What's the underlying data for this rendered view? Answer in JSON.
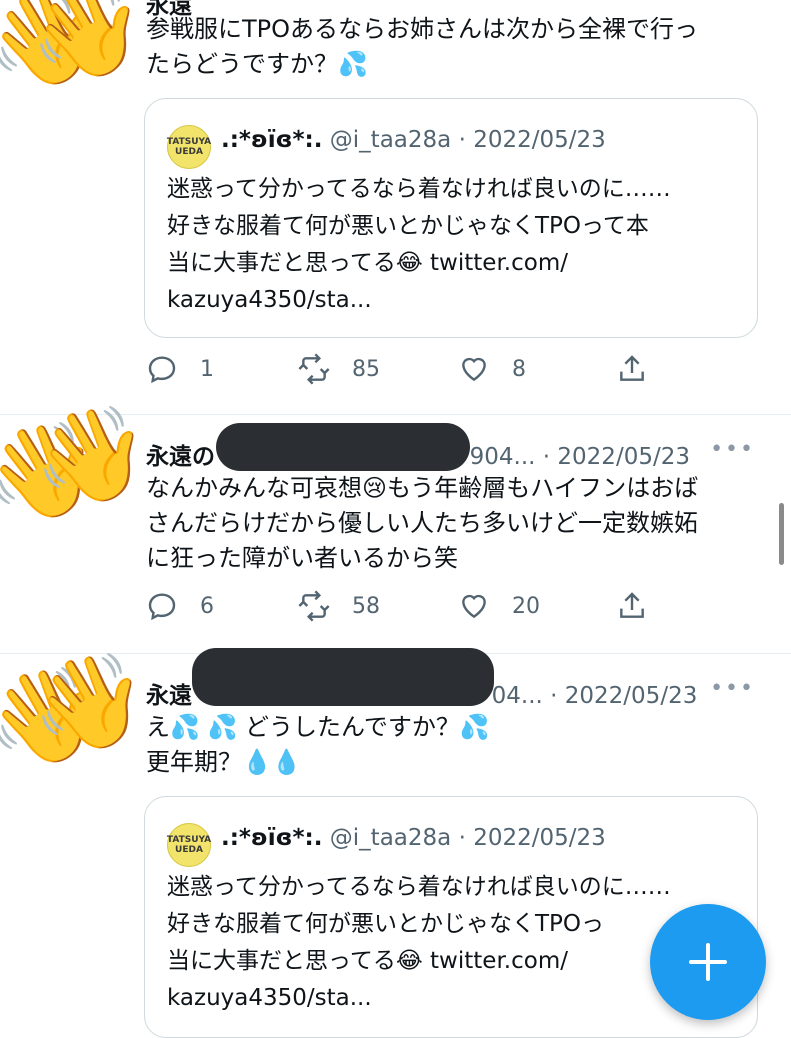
{
  "tweets": [
    {
      "author": "永遠",
      "time": "2022/05/23",
      "text_lines": [
        "参戦服にTPOあるならお姉さんは次から全裸で行っ",
        "たらどうですか？💦"
      ],
      "quote": {
        "avatar_text": "TATSUYA UEDA",
        "name": ".:*ʚïɞ*:.",
        "handle": "@i_taa28a",
        "sep": "·",
        "time": "2022/05/23",
        "lines": [
          "迷惑って分かってるなら着なければ良いのに……",
          "好きな服着て何が悪いとかじゃなくTPOって本",
          "当に大事だと思ってる😂 twitter.com/",
          "kazuya4350/sta..."
        ]
      },
      "actions": {
        "reply": "1",
        "retweet": "85",
        "like": "8"
      }
    },
    {
      "author": "永遠の",
      "handle_tail": "904...",
      "sep": "·",
      "time": "2022/05/23",
      "more": "•••",
      "text_lines": [
        "なんかみんな可哀想😢もう年齢層もハイフンはおば",
        "さんだらけだから優しい人たち多いけど一定数嫉妬",
        "に狂った障がい者いるから笑"
      ],
      "actions": {
        "reply": "6",
        "retweet": "58",
        "like": "20"
      }
    },
    {
      "author": "永遠",
      "handle_tail": "04...",
      "sep": "·",
      "time": "2022/05/23",
      "more": "•••",
      "text_lines": [
        "え💦 💦 どうしたんですか？💦",
        "更年期？💧💧"
      ],
      "quote": {
        "avatar_text": "TATSUYA UEDA",
        "name": ".:*ʚïɞ*:.",
        "handle": "@i_taa28a",
        "sep": "·",
        "time": "2022/05/23",
        "lines": [
          "迷惑って分かってるなら着なければ良いのに……",
          "好きな服着て何が悪いとかじゃなくTPOっ",
          "当に大事だと思ってる😂 twitter.com/",
          "kazuya4350/sta..."
        ]
      }
    }
  ],
  "icons": [
    "reply-icon",
    "retweet-icon",
    "like-icon",
    "share-icon",
    "plus-icon"
  ],
  "colors": {
    "accent": "#1d9bf0",
    "muted": "#536471",
    "border": "#cfd9de"
  }
}
